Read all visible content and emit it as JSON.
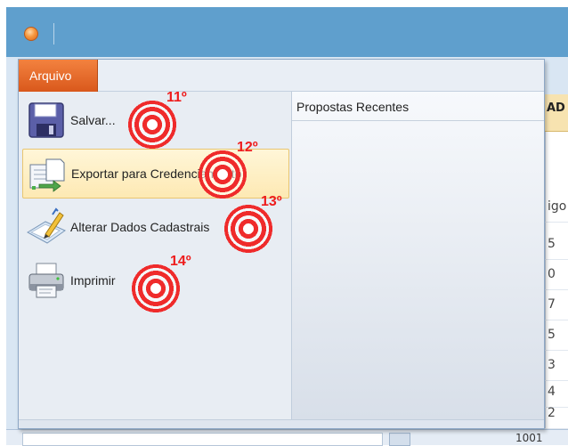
{
  "window": {
    "orb_icon": "app-orb-icon"
  },
  "menu": {
    "tab_label": "Arquivo",
    "items": [
      {
        "label": "Salvar...",
        "icon": "save-icon"
      },
      {
        "label": "Exportar para Credenciamento",
        "icon": "export-icon"
      },
      {
        "label": "Alterar Dados Cadastrais",
        "icon": "edit-data-icon"
      },
      {
        "label": "Imprimir",
        "icon": "printer-icon"
      }
    ],
    "recent_title": "Propostas Recentes"
  },
  "annotations": [
    "11º",
    "12º",
    "13º",
    "14º"
  ],
  "background": {
    "column_header": "AD",
    "cells": [
      "igo",
      "5",
      "0",
      "7",
      "5",
      "3",
      "4",
      "2"
    ],
    "footer_number": "1001"
  },
  "colors": {
    "titlebar": "#5f9fcd",
    "tab": "#e56a2b",
    "highlight": "#fdeeba",
    "marker": "#ef2b2b"
  }
}
